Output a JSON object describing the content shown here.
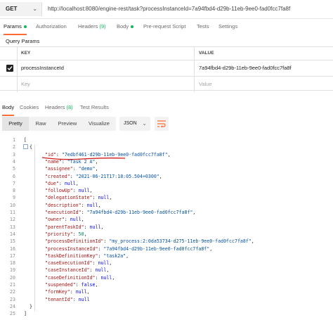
{
  "request": {
    "method": "GET",
    "url": "http://localhost:8080/engine-rest/task?processInstanceId=7a94fbd4-d29b-11eb-9ee0-fad0fcc7fa8f"
  },
  "request_tabs": {
    "params": "Params",
    "authorization": "Authorization",
    "headers": "Headers",
    "headers_count": "(9)",
    "body": "Body",
    "prerequest": "Pre-request Script",
    "tests": "Tests",
    "settings": "Settings"
  },
  "query_params": {
    "title": "Query Params",
    "key_header": "KEY",
    "value_header": "VALUE",
    "row_key": "processInstanceId",
    "row_value": "7a94fbd4-d29b-11eb-9ee0-fad0fcc7fa8f",
    "key_placeholder": "Key",
    "value_placeholder": "Value"
  },
  "response_tabs": {
    "body": "Body",
    "cookies": "Cookies",
    "headers": "Headers",
    "headers_count": "(8)",
    "test_results": "Test Results"
  },
  "toolbar": {
    "pretty": "Pretty",
    "raw": "Raw",
    "preview": "Preview",
    "visualize": "Visualize",
    "format": "JSON"
  },
  "colors": {
    "accent": "#ff6c37",
    "status_green": "#0cbb52",
    "json_key": "#a31515",
    "json_string": "#0451a5",
    "json_number": "#098658",
    "json_keyword": "#0000ff"
  },
  "response_lines": [
    {
      "n": "1",
      "text": "["
    },
    {
      "n": "2",
      "text": "{"
    },
    {
      "n": "3",
      "key": "\"id\"",
      "val": "\"7edbf461-d29b-11eb-9ee0-fad0fcc7fa8f\"",
      "t": "s"
    },
    {
      "n": "4",
      "key": "\"name\"",
      "val": "\"Task 2 A\"",
      "t": "s"
    },
    {
      "n": "5",
      "key": "\"assignee\"",
      "val": "\"demo\"",
      "t": "s"
    },
    {
      "n": "6",
      "key": "\"created\"",
      "val": "\"2021-06-21T17:18:05.504+0300\"",
      "t": "s"
    },
    {
      "n": "7",
      "key": "\"due\"",
      "val": "null",
      "t": "kw"
    },
    {
      "n": "8",
      "key": "\"followUp\"",
      "val": "null",
      "t": "kw"
    },
    {
      "n": "9",
      "key": "\"delegationState\"",
      "val": "null",
      "t": "kw"
    },
    {
      "n": "10",
      "key": "\"description\"",
      "val": "null",
      "t": "kw"
    },
    {
      "n": "11",
      "key": "\"executionId\"",
      "val": "\"7a94fbd4-d29b-11eb-9ee0-fad0fcc7fa8f\"",
      "t": "s"
    },
    {
      "n": "12",
      "key": "\"owner\"",
      "val": "null",
      "t": "kw"
    },
    {
      "n": "13",
      "key": "\"parentTaskId\"",
      "val": "null",
      "t": "kw"
    },
    {
      "n": "14",
      "key": "\"priority\"",
      "val": "50",
      "t": "n"
    },
    {
      "n": "15",
      "key": "\"processDefinitionId\"",
      "val": "\"my_process:2:0da53734-d275-11eb-9ee0-fad0fcc7fa8f\"",
      "t": "s"
    },
    {
      "n": "16",
      "key": "\"processInstanceId\"",
      "val": "\"7a94fbd4-d29b-11eb-9ee0-fad0fcc7fa8f\"",
      "t": "s"
    },
    {
      "n": "17",
      "key": "\"taskDefinitionKey\"",
      "val": "\"task2a\"",
      "t": "s"
    },
    {
      "n": "18",
      "key": "\"caseExecutionId\"",
      "val": "null",
      "t": "kw"
    },
    {
      "n": "19",
      "key": "\"caseInstanceId\"",
      "val": "null",
      "t": "kw"
    },
    {
      "n": "20",
      "key": "\"caseDefinitionId\"",
      "val": "null",
      "t": "kw"
    },
    {
      "n": "21",
      "key": "\"suspended\"",
      "val": "false",
      "t": "kw"
    },
    {
      "n": "22",
      "key": "\"formKey\"",
      "val": "null",
      "t": "kw"
    },
    {
      "n": "23",
      "key": "\"tenantId\"",
      "val": "null",
      "t": "kw",
      "last": true
    },
    {
      "n": "24",
      "text": "}"
    },
    {
      "n": "25",
      "text": "]"
    }
  ]
}
